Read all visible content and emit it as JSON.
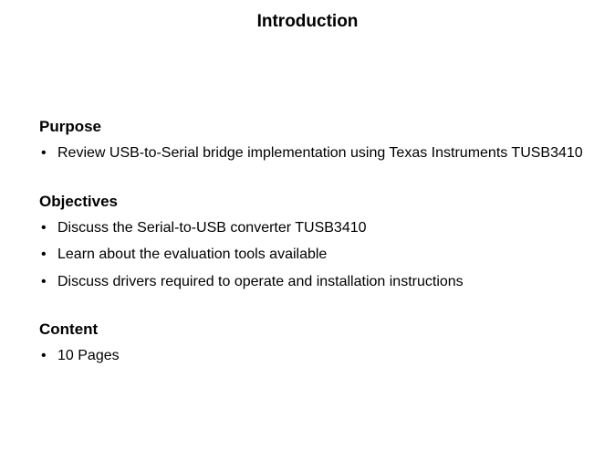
{
  "title": "Introduction",
  "sections": [
    {
      "heading": "Purpose",
      "items": [
        "Review USB-to-Serial bridge implementation using Texas Instruments TUSB3410"
      ]
    },
    {
      "heading": "Objectives",
      "items": [
        "Discuss the Serial-to-USB converter TUSB3410",
        "Learn about the evaluation tools available",
        "Discuss drivers required to operate and installation instructions"
      ]
    },
    {
      "heading": "Content",
      "items": [
        "10 Pages"
      ]
    }
  ]
}
